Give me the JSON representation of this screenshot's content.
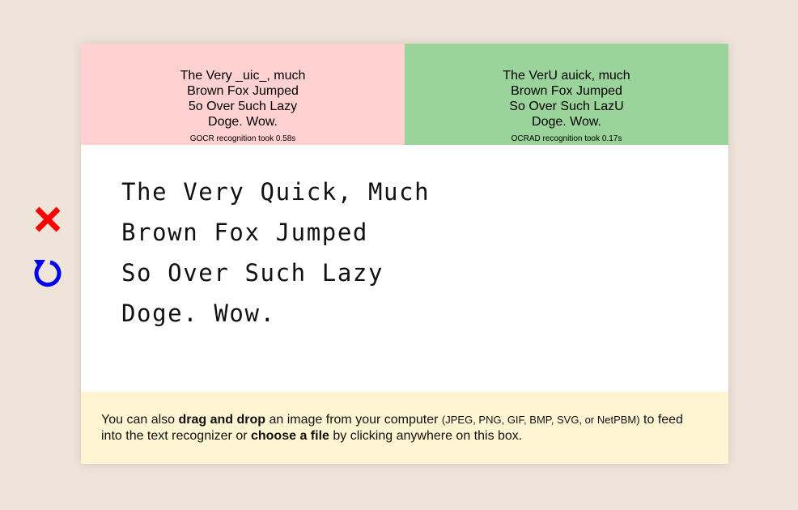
{
  "controls": {
    "clear_icon_color": "#ff0000",
    "reload_icon_color": "#0000ee"
  },
  "results": {
    "gocr": {
      "text": "The Very _uic_, much\nBrown Fox Jumped\n5o Over 5uch Lazy\nDoge. Wow.",
      "timing": "GOCR recognition took 0.58s",
      "background": "#ffd1d1"
    },
    "ocrad": {
      "text": "The VerU auick, much\nBrown Fox Jumped\nSo Over Such LazU\nDoge. Wow.",
      "timing": "OCRAD recognition took 0.17s",
      "background": "#9ad49a"
    }
  },
  "canvas": {
    "lines": [
      "The Very Quick, Much",
      "Brown Fox Jumped",
      "So Over Such Lazy",
      "Doge. Wow."
    ]
  },
  "dropzone": {
    "part1": "You can also ",
    "bold1": "drag and drop",
    "part2": " an image from your computer ",
    "formats": "(JPEG, PNG, GIF, BMP, SVG, or NetPBM)",
    "part3": " to feed into the text recognizer or ",
    "bold2": "choose a file",
    "part4": " by clicking anywhere on this box."
  }
}
